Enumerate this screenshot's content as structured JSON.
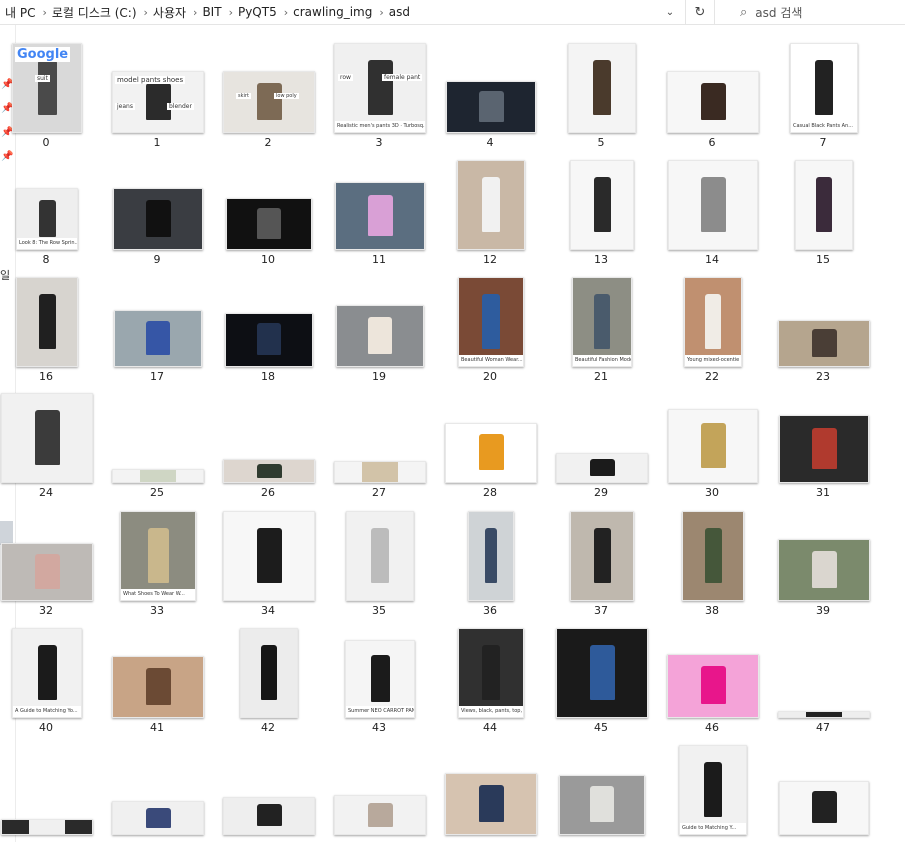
{
  "address_bar": {
    "crumbs": [
      "내 PC",
      "로컬 디스크 (C:)",
      "사용자",
      "BIT",
      "PyQT5",
      "crawling_img",
      "asd"
    ],
    "chevron": "›"
  },
  "search": {
    "placeholder": "asd 검색"
  },
  "left_pane": {
    "partial_text": "일"
  },
  "icons": [
    "chevron-down-icon",
    "refresh-icon",
    "search-icon",
    "pin-icon"
  ],
  "files": [
    {
      "name": "0",
      "caption": ""
    },
    {
      "name": "1",
      "caption": ""
    },
    {
      "name": "2",
      "caption": ""
    },
    {
      "name": "3",
      "caption": "Realistic men's pants 3D · Turbosq..."
    },
    {
      "name": "4",
      "caption": ""
    },
    {
      "name": "5",
      "caption": ""
    },
    {
      "name": "6",
      "caption": ""
    },
    {
      "name": "7",
      "caption": "Casual Black Pants An..."
    },
    {
      "name": "8",
      "caption": "Look 8: The Row Sprin..."
    },
    {
      "name": "9",
      "caption": ""
    },
    {
      "name": "10",
      "caption": ""
    },
    {
      "name": "11",
      "caption": ""
    },
    {
      "name": "12",
      "caption": ""
    },
    {
      "name": "13",
      "caption": ""
    },
    {
      "name": "14",
      "caption": ""
    },
    {
      "name": "15",
      "caption": ""
    },
    {
      "name": "16",
      "caption": ""
    },
    {
      "name": "17",
      "caption": ""
    },
    {
      "name": "18",
      "caption": ""
    },
    {
      "name": "19",
      "caption": ""
    },
    {
      "name": "20",
      "caption": "Beautiful Woman Wear..."
    },
    {
      "name": "21",
      "caption": "Beautiful Fashion Mode..."
    },
    {
      "name": "22",
      "caption": "Young mixed-ocentie g..."
    },
    {
      "name": "23",
      "caption": ""
    },
    {
      "name": "24",
      "caption": ""
    },
    {
      "name": "25",
      "caption": ""
    },
    {
      "name": "26",
      "caption": ""
    },
    {
      "name": "27",
      "caption": ""
    },
    {
      "name": "28",
      "caption": ""
    },
    {
      "name": "29",
      "caption": ""
    },
    {
      "name": "30",
      "caption": ""
    },
    {
      "name": "31",
      "caption": ""
    },
    {
      "name": "32",
      "caption": ""
    },
    {
      "name": "33",
      "caption": "What Shoes To Wear W..."
    },
    {
      "name": "34",
      "caption": ""
    },
    {
      "name": "35",
      "caption": ""
    },
    {
      "name": "36",
      "caption": ""
    },
    {
      "name": "37",
      "caption": ""
    },
    {
      "name": "38",
      "caption": ""
    },
    {
      "name": "39",
      "caption": ""
    },
    {
      "name": "40",
      "caption": "A Guide to Matching Yo..."
    },
    {
      "name": "41",
      "caption": ""
    },
    {
      "name": "42",
      "caption": ""
    },
    {
      "name": "43",
      "caption": "Summer NEO CARROT PAN..."
    },
    {
      "name": "44",
      "caption": "Views, black, pants, top, bo..."
    },
    {
      "name": "45",
      "caption": ""
    },
    {
      "name": "46",
      "caption": ""
    },
    {
      "name": "47",
      "caption": ""
    },
    {
      "name": "",
      "caption": ""
    },
    {
      "name": "",
      "caption": ""
    },
    {
      "name": "",
      "caption": ""
    },
    {
      "name": "",
      "caption": ""
    },
    {
      "name": "",
      "caption": ""
    },
    {
      "name": "",
      "caption": ""
    },
    {
      "name": "",
      "caption": "Guide to Matching Y..."
    },
    {
      "name": "",
      "caption": ""
    }
  ],
  "thumb_snippets": {
    "google_logo": "Google",
    "chip_suit": "suit",
    "search_query": "model pants shoes",
    "chip_jeans": "jeans",
    "chip_blender": "blender",
    "chip_skirt": "skirt",
    "chip_lowpoly": "low poly",
    "chip_row": "row",
    "chip_female": "female pant"
  },
  "colors": {
    "accent": "#0078d7",
    "pane_selected": "#cfd4da"
  }
}
